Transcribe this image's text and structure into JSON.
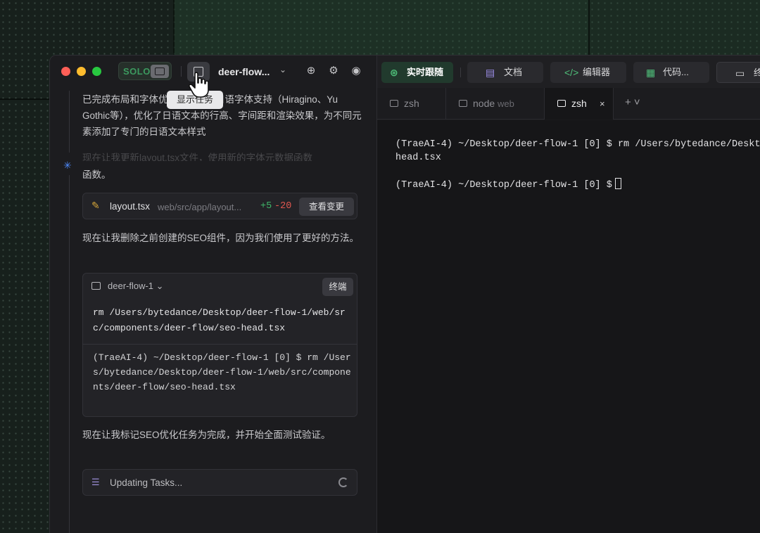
{
  "window": {
    "solo_label": "SOLO",
    "project_name": "deer-flow...",
    "tooltip": "显示任务"
  },
  "chat": {
    "messages": [
      "已完成布局和字体优化，增加了日语字体支持（Hiragino、Yu Gothic等），优化了日语文本的行高、字间距和渲染效果，为不同元素添加了专门的日语文本样式",
      "函数。",
      "现在让我删除之前创建的SEO组件，因为我们使用了更好的方法。",
      "现在让我标记SEO优化任务为完成，并开始全面测试验证。"
    ],
    "file_change": {
      "file": "layout.tsx",
      "path": "web/src/app/layout...",
      "additions": "+5",
      "deletions": "-20",
      "view_button": "查看变更"
    },
    "terminal_card": {
      "name": "deer-flow-1",
      "button": "终端",
      "command": "rm /Users/bytedance/Desktop/deer-flow-1/web/src/components/deer-flow/seo-head.tsx",
      "output": "(TraeAI-4) ~/Desktop/deer-flow-1 [0] $ rm /Users/bytedance/Desktop/deer-flow-1/web/src/components/deer-flow/seo-head.tsx"
    },
    "task": {
      "label": "Updating Tasks..."
    }
  },
  "right_tabs": [
    {
      "label": "实时跟随",
      "icon": "follow-icon"
    },
    {
      "label": "文档",
      "icon": "doc-icon"
    },
    {
      "label": "编辑器",
      "icon": "code-icon"
    },
    {
      "label": "代码...",
      "icon": "table-icon"
    },
    {
      "label": "终",
      "icon": "terminal-icon"
    }
  ],
  "terminal_tabs": [
    {
      "label": "zsh",
      "sub": ""
    },
    {
      "label": "node",
      "sub": "web"
    },
    {
      "label": "zsh",
      "sub": "",
      "close": "×"
    }
  ],
  "plus_label": "+ ˅",
  "terminal": {
    "lines": [
      "(TraeAI-4) ~/Desktop/deer-flow-1 [0] $ rm /Users/bytedance/Deskt",
      "head.tsx",
      "(TraeAI-4) ~/Desktop/deer-flow-1 [0] $"
    ]
  }
}
